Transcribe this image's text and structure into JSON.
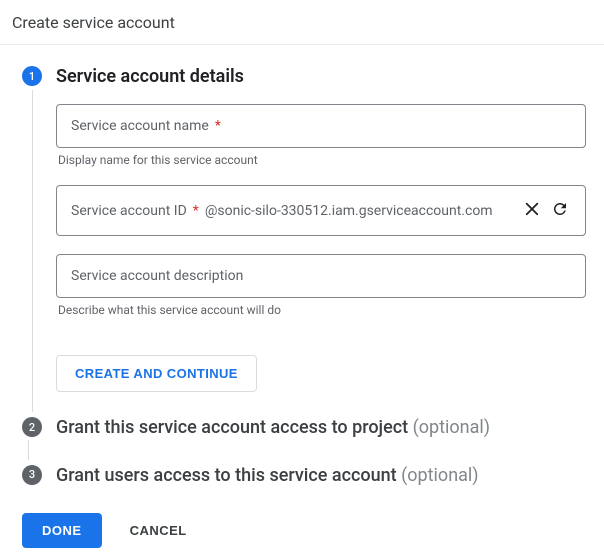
{
  "header": {
    "title": "Create service account"
  },
  "steps": {
    "step1": {
      "number": "1",
      "title": "Service account details",
      "fields": {
        "name": {
          "label": "Service account name",
          "helper": "Display name for this service account"
        },
        "id": {
          "label": "Service account ID",
          "suffix": "@sonic-silo-330512.iam.gserviceaccount.com"
        },
        "description": {
          "label": "Service account description",
          "helper": "Describe what this service account will do"
        }
      },
      "create_continue_label": "CREATE AND CONTINUE"
    },
    "step2": {
      "number": "2",
      "title": "Grant this service account access to project",
      "optional": "(optional)"
    },
    "step3": {
      "number": "3",
      "title": "Grant users access to this service account",
      "optional": "(optional)"
    }
  },
  "footer": {
    "done_label": "DONE",
    "cancel_label": "CANCEL"
  },
  "required_marker": "*"
}
